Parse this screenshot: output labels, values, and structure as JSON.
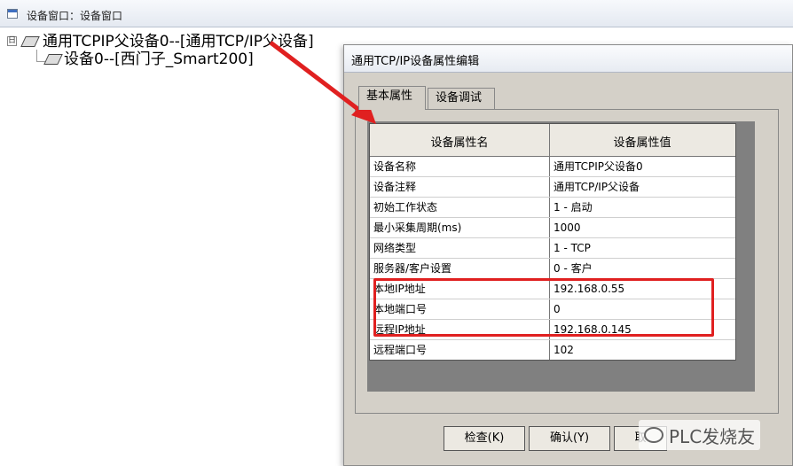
{
  "window": {
    "title": "设备窗口：设备窗口"
  },
  "tree": {
    "root": {
      "expander": "日",
      "label": "通用TCPIP父设备0--[通用TCP/IP父设备]"
    },
    "child": {
      "label": "设备0--[西门子_Smart200]"
    }
  },
  "dialog": {
    "title": "通用TCP/IP设备属性编辑",
    "tabs": [
      "基本属性",
      "设备调试"
    ],
    "active_tab": "基本属性",
    "table": {
      "headers": [
        "设备属性名",
        "设备属性值"
      ],
      "rows": [
        [
          "设备名称",
          "通用TCPIP父设备0"
        ],
        [
          "设备注释",
          "通用TCP/IP父设备"
        ],
        [
          "初始工作状态",
          "1 - 启动"
        ],
        [
          "最小采集周期(ms)",
          "1000"
        ],
        [
          "网络类型",
          "1 - TCP"
        ],
        [
          "服务器/客户设置",
          "0 - 客户"
        ],
        [
          "本地IP地址",
          "192.168.0.55"
        ],
        [
          "本地端口号",
          "0"
        ],
        [
          "远程IP地址",
          "192.168.0.145"
        ],
        [
          "远程端口号",
          "102"
        ]
      ]
    },
    "buttons": {
      "check": "检查(K)",
      "confirm": "确认(Y)",
      "cancel": "取"
    }
  },
  "watermark": {
    "text": "PLC发烧友"
  },
  "colors": {
    "highlight": "#e02020",
    "arrow": "#e02020"
  }
}
